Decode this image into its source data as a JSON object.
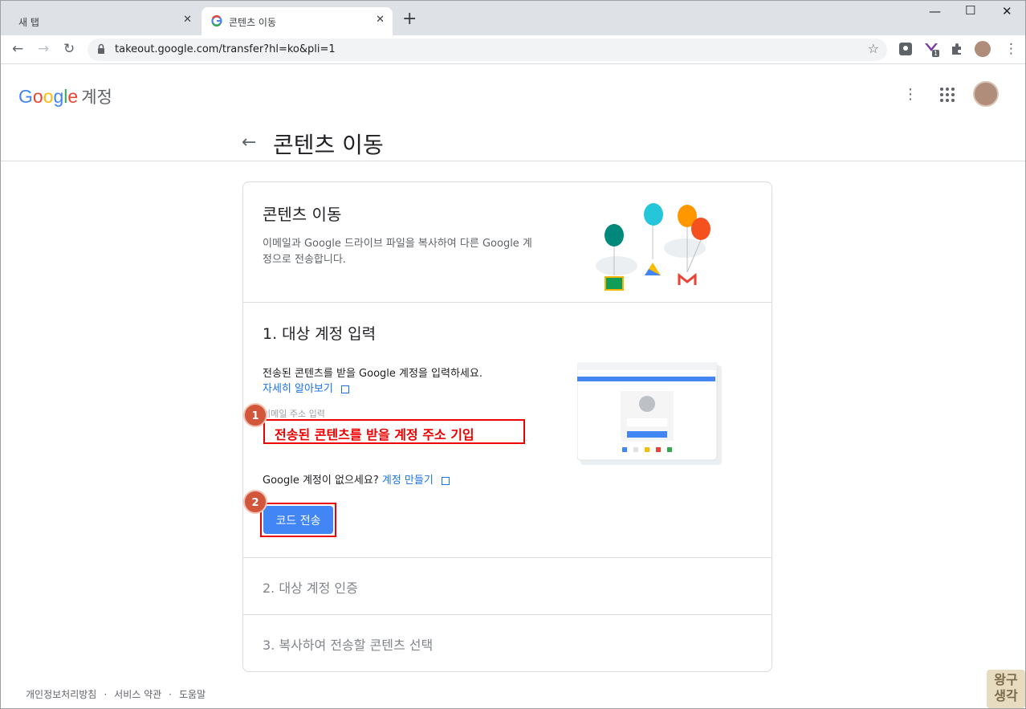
{
  "tabs": [
    {
      "title": "새 탭"
    },
    {
      "title": "콘텐츠 이동"
    }
  ],
  "omnibox": {
    "url": "takeout.google.com/transfer?hl=ko&pli=1"
  },
  "header": {
    "logo_parts": [
      "G",
      "o",
      "o",
      "g",
      "l",
      "e"
    ],
    "account_label": "계정"
  },
  "page": {
    "title": "콘텐츠 이동"
  },
  "intro": {
    "heading": "콘텐츠 이동",
    "description": "이메일과 Google 드라이브 파일을 복사하여 다른 Google 계정으로 전송합니다."
  },
  "step1": {
    "heading": "1. 대상 계정 입력",
    "description": "전송된 콘텐츠를 받을 Google 계정을 입력하세요.",
    "learn_more": "자세히 알아보기",
    "email_label": "이메일 주소 입력",
    "email_placeholder": "",
    "annotation": "전송된 콘텐츠를 받을 계정 주소 기입",
    "no_account": "Google 계정이 없으세요?",
    "create_account": "계정 만들기",
    "send_button": "코드 전송",
    "badge1": "1",
    "badge2": "2"
  },
  "step2": {
    "heading": "2. 대상 계정 인증"
  },
  "step3": {
    "heading": "3. 복사하여 전송할 콘텐츠 선택"
  },
  "footer": {
    "privacy": "개인정보처리방침",
    "terms": "서비스 약관",
    "help": "도움말",
    "separator": "·"
  },
  "watermark": {
    "line1": "왕구",
    "line2": "생각"
  },
  "ext_badge_count": "1"
}
